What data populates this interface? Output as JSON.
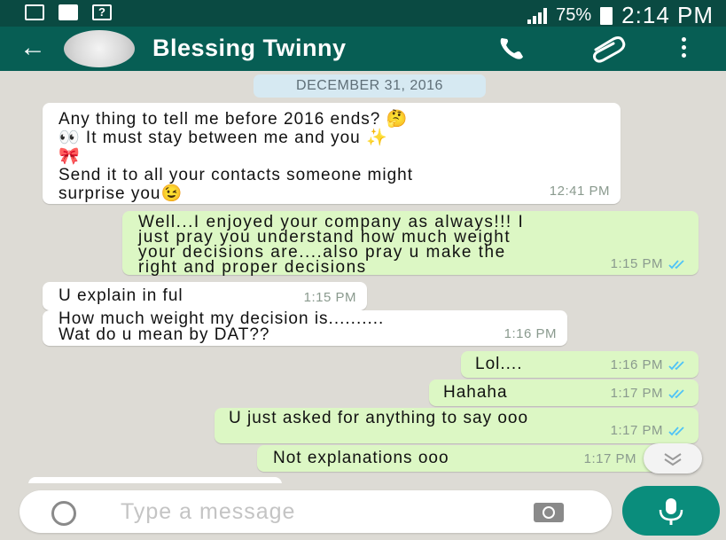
{
  "status_bar": {
    "battery": "75%",
    "time": "2:14 PM"
  },
  "header": {
    "title": "Blessing Twinny"
  },
  "date_label": "DECEMBER 31, 2016",
  "messages": [
    {
      "dir": "in",
      "text": "Any thing to tell me before 2016 ends? 🤔\n👀 It must stay between me and you ✨\n🎀\nSend it to all your contacts someone might\nsurprise you😉",
      "time": "12:41 PM"
    },
    {
      "dir": "out",
      "text": "Well...I enjoyed your company as always!!! I\njust pray you understand how much weight\nyour decisions are....also pray u make the\nright and proper decisions",
      "time": "1:15 PM"
    },
    {
      "dir": "in",
      "text": "U explain in ful",
      "time": "1:15 PM"
    },
    {
      "dir": "in",
      "text": "How much weight my decision is..........\nWat do u mean by DAT??",
      "time": "1:16 PM"
    },
    {
      "dir": "out",
      "text": "Lol....",
      "time": "1:16 PM"
    },
    {
      "dir": "out",
      "text": "Hahaha",
      "time": "1:17 PM"
    },
    {
      "dir": "out",
      "text": "U just asked for anything to say ooo",
      "time": "1:17 PM"
    },
    {
      "dir": "out",
      "text": "Not explanations ooo",
      "time": "1:17 PM"
    }
  ],
  "input": {
    "placeholder": "Type a message"
  },
  "colors": {
    "app_bar": "#075e54",
    "status_bar": "#0a4a42",
    "outgoing": "#dcf7c4",
    "incoming": "#ffffff",
    "ticks": "#4fc3f7",
    "fab": "#0a8d7c"
  },
  "icons": [
    "image-icon",
    "bbm-icon",
    "help-icon",
    "signal-icon",
    "battery-icon",
    "back-arrow-icon",
    "call-icon",
    "attach-icon",
    "more-vert-icon",
    "double-check-icon",
    "scroll-down-icon",
    "emoji-icon",
    "camera-icon",
    "mic-icon"
  ]
}
